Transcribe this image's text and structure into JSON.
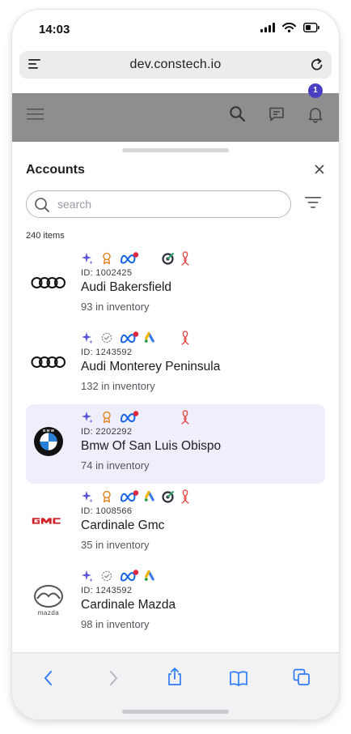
{
  "status": {
    "time": "14:03"
  },
  "browser": {
    "domain": "dev.constech.io"
  },
  "header": {
    "notification_count": "1"
  },
  "sheet": {
    "title": "Accounts",
    "search_placeholder": "search",
    "items_count": "240 items"
  },
  "accounts": [
    {
      "id": "ID: 1002425",
      "name": "Audi Bakersfield",
      "inventory": "93 in inventory",
      "logo": "audi-logo",
      "selected": false,
      "icons": [
        "sparkle-icon",
        "award-icon",
        "meta-icon",
        "target-icon",
        "ribbon-icon"
      ]
    },
    {
      "id": "ID: 1243592",
      "name": "Audi Monterey Peninsula",
      "inventory": "132 in inventory",
      "logo": "audi-logo",
      "selected": false,
      "icons": [
        "sparkle-icon",
        "badge-check-icon",
        "meta-icon",
        "google-ads-icon",
        "ribbon-icon"
      ]
    },
    {
      "id": "ID: 2202292",
      "name": "Bmw Of San Luis Obispo",
      "inventory": "74 in inventory",
      "logo": "bmw-logo",
      "selected": true,
      "icons": [
        "sparkle-icon",
        "award-icon",
        "meta-icon",
        "ribbon-icon"
      ]
    },
    {
      "id": "ID: 1008566",
      "name": "Cardinale Gmc",
      "inventory": "35 in inventory",
      "logo": "gmc-logo",
      "selected": false,
      "icons": [
        "sparkle-icon",
        "award-icon",
        "meta-icon",
        "google-ads-icon",
        "target-icon",
        "ribbon-icon"
      ]
    },
    {
      "id": "ID: 1243592",
      "name": "Cardinale Mazda",
      "inventory": "98 in inventory",
      "logo": "mazda-logo",
      "selected": false,
      "icons": [
        "sparkle-icon",
        "badge-check-icon",
        "meta-icon",
        "google-ads-icon"
      ]
    }
  ],
  "colors": {
    "accent": "#4a3fc2",
    "selected_row": "#efeffb",
    "ios_blue": "#2f7bf5",
    "meta_dot": "#e0263a"
  }
}
